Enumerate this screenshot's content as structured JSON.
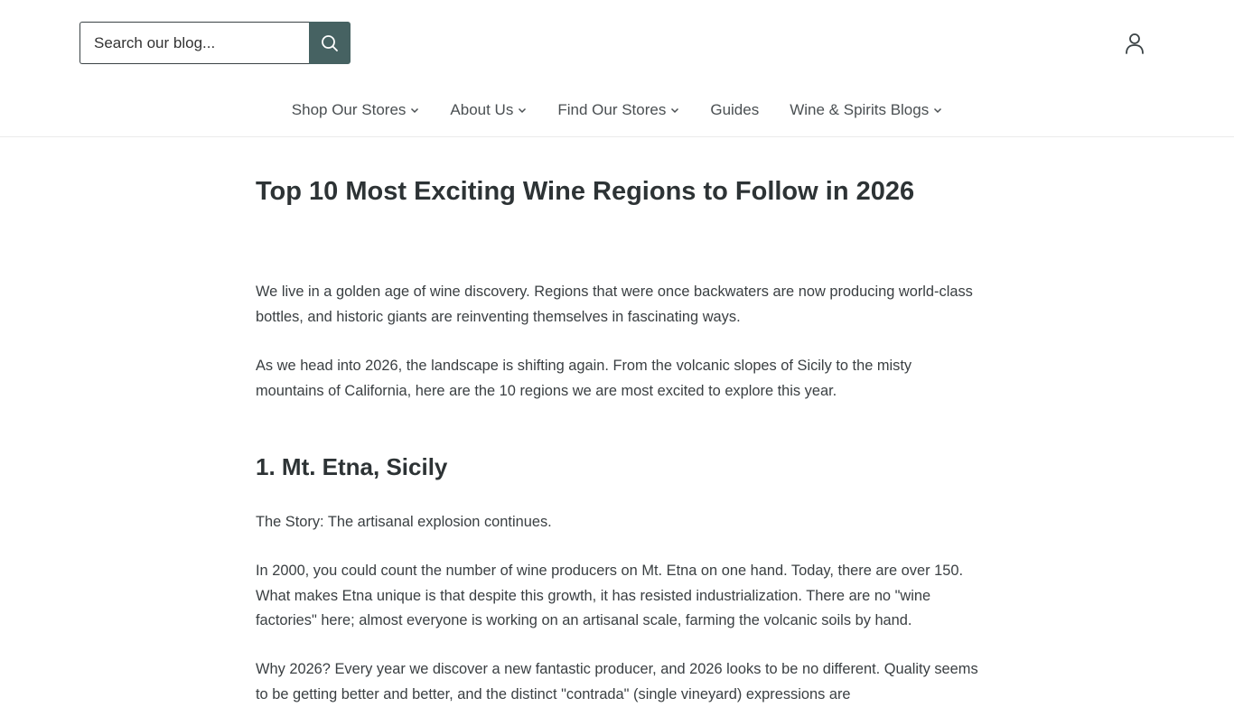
{
  "header": {
    "search_placeholder": "Search our blog...",
    "search_icon": "search-icon",
    "account_icon": "user-icon"
  },
  "nav": [
    {
      "label": "Shop Our Stores",
      "has_dropdown": true
    },
    {
      "label": "About Us",
      "has_dropdown": true
    },
    {
      "label": "Find Our Stores",
      "has_dropdown": true
    },
    {
      "label": "Guides",
      "has_dropdown": false
    },
    {
      "label": "Wine & Spirits Blogs",
      "has_dropdown": true
    }
  ],
  "article": {
    "title": "Top 10 Most Exciting Wine Regions to Follow in 2026",
    "intro1": "We live in a golden age of wine discovery. Regions that were once backwaters are now producing world-class bottles, and historic giants are reinventing themselves in fascinating ways.",
    "intro2": "As we head into 2026, the landscape is shifting again. From the volcanic slopes of Sicily to the misty mountains of California, here are the 10 regions we are most excited to explore this year.",
    "section1_heading": "1. Mt. Etna, Sicily",
    "section1_story": "The Story: The artisanal explosion continues.",
    "section1_para": "In 2000, you could count the number of wine producers on Mt. Etna on one hand. Today, there are over 150. What makes Etna unique is that despite this growth, it has resisted industrialization. There are no \"wine factories\" here; almost everyone is working on an artisanal scale, farming the volcanic soils by hand.",
    "section1_why": "Why 2026? Every year we discover a new fantastic producer, and 2026 looks to be no different. Quality seems to be getting better and better, and the distinct \"contrada\" (single vineyard) expressions are"
  },
  "colors": {
    "search_button_bg": "#466262",
    "text": "#3a3f42",
    "heading": "#2d3335"
  }
}
